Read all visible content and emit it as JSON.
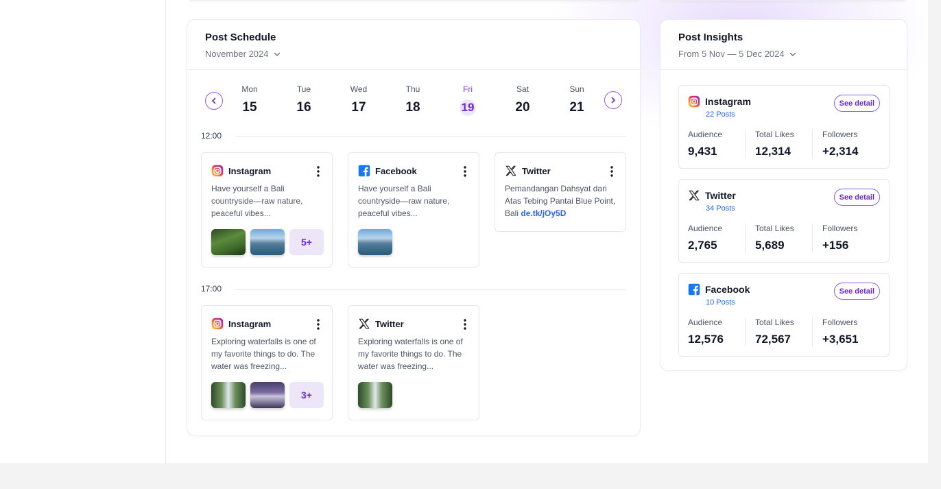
{
  "colors": {
    "accent": "#8b5cf6",
    "accent_dark": "#6d28d9",
    "link": "#2563eb",
    "facebook": "#1877f2",
    "instagram_from": "#feda75",
    "instagram_to": "#d62976",
    "twitter": "#111111"
  },
  "schedule": {
    "title": "Post Schedule",
    "month": "November 2024",
    "days": [
      {
        "name": "Mon",
        "num": "15",
        "active": false
      },
      {
        "name": "Tue",
        "num": "16",
        "active": false
      },
      {
        "name": "Wed",
        "num": "17",
        "active": false
      },
      {
        "name": "Thu",
        "num": "18",
        "active": false
      },
      {
        "name": "Fri",
        "num": "19",
        "active": true
      },
      {
        "name": "Sat",
        "num": "20",
        "active": false
      },
      {
        "name": "Sun",
        "num": "21",
        "active": false
      }
    ],
    "slots": [
      {
        "time": "12:00",
        "posts": [
          {
            "platform": "Instagram",
            "icon": "instagram-icon",
            "text": "Have yourself a Bali countryside—raw nature, peaceful vibes...",
            "link": "",
            "thumbs": [
              "rice-terrace-photo",
              "temple-lake-photo"
            ],
            "more": "5+"
          },
          {
            "platform": "Facebook",
            "icon": "facebook-icon",
            "text": "Have yourself a Bali countryside—raw nature, peaceful vibes...",
            "link": "",
            "thumbs": [
              "temple-lake-photo"
            ],
            "more": ""
          },
          {
            "platform": "Twitter",
            "icon": "x-icon",
            "text": "Pemandangan Dahsyat dari Atas Tebing Pantai Blue Point, Bali",
            "link": "de.tk/jOy5D",
            "thumbs": [],
            "more": ""
          }
        ]
      },
      {
        "time": "17:00",
        "posts": [
          {
            "platform": "Instagram",
            "icon": "instagram-icon",
            "text": "Exploring waterfalls is one of my favorite things to do. The water was freezing...",
            "link": "",
            "thumbs": [
              "waterfall-photo",
              "waterfall-dusk-photo"
            ],
            "more": "3+"
          },
          {
            "platform": "Twitter",
            "icon": "x-icon",
            "text": "Exploring waterfalls is one of my favorite things to do. The water was freezing...",
            "link": "",
            "thumbs": [
              "waterfall-photo"
            ],
            "more": ""
          }
        ]
      }
    ]
  },
  "insights": {
    "title": "Post Insights",
    "range": "From 5 Nov — 5 Dec 2024",
    "detail_label": "See detail",
    "labels": {
      "audience": "Audience",
      "likes": "Total Likes",
      "followers": "Followers"
    },
    "items": [
      {
        "platform": "Instagram",
        "icon": "instagram-icon",
        "posts": "22 Posts",
        "audience": "9,431",
        "likes": "12,314",
        "followers": "+2,314"
      },
      {
        "platform": "Twitter",
        "icon": "x-icon",
        "posts": "34 Posts",
        "audience": "2,765",
        "likes": "5,689",
        "followers": "+156"
      },
      {
        "platform": "Facebook",
        "icon": "facebook-icon",
        "posts": "10 Posts",
        "audience": "12,576",
        "likes": "72,567",
        "followers": "+3,651"
      }
    ]
  }
}
